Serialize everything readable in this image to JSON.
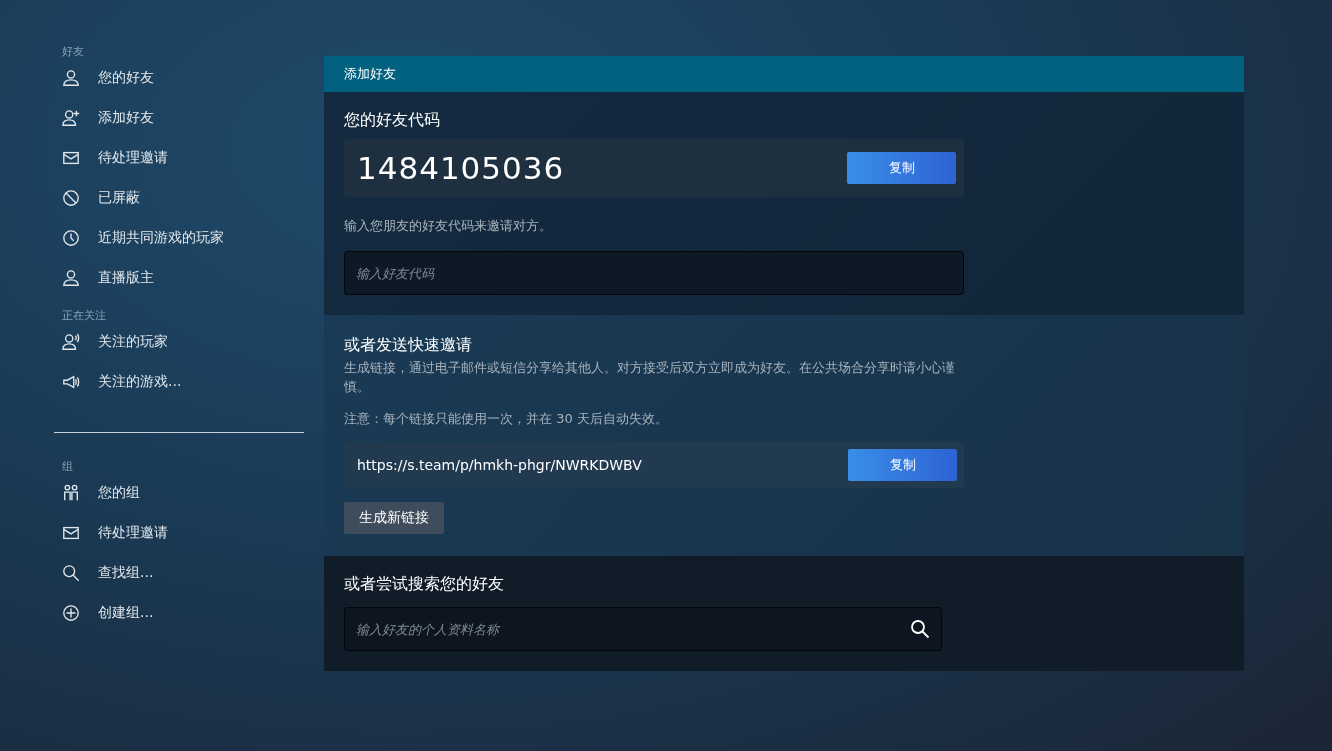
{
  "sidebar": {
    "sections": [
      {
        "heading": "好友",
        "divider": false,
        "items": [
          {
            "kind": "person",
            "label": "您的好友"
          },
          {
            "kind": "person-add",
            "label": "添加好友"
          },
          {
            "kind": "envelope",
            "label": "待处理邀请"
          },
          {
            "kind": "blocked",
            "label": "已屏蔽"
          },
          {
            "kind": "clock",
            "label": "近期共同游戏的玩家"
          },
          {
            "kind": "person",
            "label": "直播版主"
          }
        ]
      },
      {
        "heading": "正在关注",
        "divider": false,
        "items": [
          {
            "kind": "person-broadcast",
            "label": "关注的玩家"
          },
          {
            "kind": "megaphone",
            "label": "关注的游戏..."
          }
        ]
      },
      {
        "heading": "组",
        "divider": true,
        "items": [
          {
            "kind": "group",
            "label": "您的组"
          },
          {
            "kind": "envelope",
            "label": "待处理邀请"
          },
          {
            "kind": "search",
            "label": "查找组..."
          },
          {
            "kind": "plus-circle",
            "label": "创建组..."
          }
        ]
      }
    ]
  },
  "panel": {
    "title": "添加好友",
    "friend_code": {
      "heading": "您的好友代码",
      "code": "1484105036",
      "copy_button": "复制",
      "hint": "输入您朋友的好友代码来邀请对方。",
      "placeholder": "输入好友代码"
    },
    "quick_invite": {
      "heading": "或者发送快速邀请",
      "description": "生成链接，通过电子邮件或短信分享给其他人。对方接受后双方立即成为好友。在公共场合分享时请小心谨慎。",
      "note": "注意：每个链接只能使用一次，并在 30 天后自动失效。",
      "link": "https://s.team/p/hmkh-phgr/NWRKDWBV",
      "copy_button": "复制",
      "generate_button": "生成新链接"
    },
    "search": {
      "heading": "或者尝试搜索您的好友",
      "placeholder": "输入好友的个人资料名称"
    }
  }
}
